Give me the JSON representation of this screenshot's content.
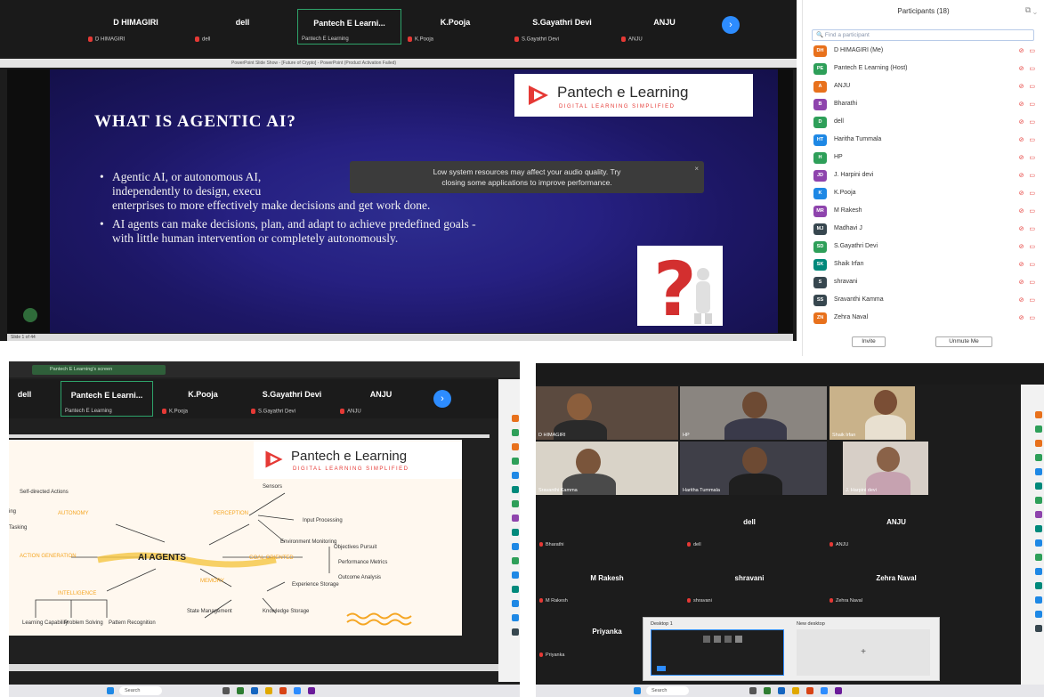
{
  "panel1": {
    "tiles": [
      {
        "name": "D HIMAGIRI",
        "sub": "D HIMAGIRI"
      },
      {
        "name": "dell",
        "sub": "dell"
      },
      {
        "name": "Pantech E Learni...",
        "sub": "Pantech E Learning",
        "active": true
      },
      {
        "name": "K.Pooja",
        "sub": "K.Pooja"
      },
      {
        "name": "S.Gayathri Devi",
        "sub": "S.Gayathri Devi"
      },
      {
        "name": "ANJU",
        "sub": "ANJU"
      }
    ],
    "share_title": "PowerPoint Slide Show - [Future of Crypto] - PowerPoint (Product Activation Failed)",
    "slide": {
      "title": "WHAT IS AGENTIC AI?",
      "bullet1_line1": "Agentic AI, or autonomous AI,",
      "bullet1_line2": "independently to design, execu",
      "bullet1_line3": "enterprises to more effectively make decisions and get work done.",
      "bullet2_line1": "AI agents can make decisions, plan, and adapt to achieve predefined goals -",
      "bullet2_line2": "with little human intervention or completely autonomously."
    },
    "logo": {
      "name": "Pantech e Learning",
      "tagline": "DIGITAL LEARNING SIMPLIFIED"
    },
    "toast": {
      "line1": "Low system resources may affect your audio quality. Try",
      "line2": "closing some applications to improve performance.",
      "close": "×"
    },
    "status": "Slide 1 of 44"
  },
  "participants": {
    "header": "Participants (18)",
    "search_placeholder": "Find a participant",
    "list": [
      {
        "initials": "DH",
        "name": "D HIMAGIRI (Me)",
        "color": "#e8711c"
      },
      {
        "initials": "PE",
        "name": "Pantech E Learning (Host)",
        "color": "#2e9f59"
      },
      {
        "initials": "A",
        "name": "ANJU",
        "color": "#e8711c"
      },
      {
        "initials": "B",
        "name": "Bharathi",
        "color": "#8e44ad"
      },
      {
        "initials": "D",
        "name": "dell",
        "color": "#2e9f59"
      },
      {
        "initials": "HT",
        "name": "Haritha Tummala",
        "color": "#1e88e5"
      },
      {
        "initials": "H",
        "name": "HP",
        "color": "#2e9f59"
      },
      {
        "initials": "JD",
        "name": "J. Harpini devi",
        "color": "#8e44ad"
      },
      {
        "initials": "K",
        "name": "K.Pooja",
        "color": "#1e88e5"
      },
      {
        "initials": "MR",
        "name": "M Rakesh",
        "color": "#8e44ad"
      },
      {
        "initials": "MJ",
        "name": "Madhavi J",
        "color": "#37474f"
      },
      {
        "initials": "SD",
        "name": "S.Gayathri Devi",
        "color": "#2e9f59"
      },
      {
        "initials": "SK",
        "name": "Shaik Irfan",
        "color": "#00897b"
      },
      {
        "initials": "S",
        "name": "shravani",
        "color": "#37474f"
      },
      {
        "initials": "SS",
        "name": "Sravanthi Kamma",
        "color": "#37474f"
      },
      {
        "initials": "ZN",
        "name": "Zehra Naval",
        "color": "#e8711c"
      }
    ],
    "invite": "Invite",
    "unmute_me": "Unmute Me"
  },
  "panel2": {
    "window_tab": "Pantech E Learning's screen",
    "tiles": [
      {
        "name": "dell",
        "sub": ""
      },
      {
        "name": "Pantech E Learni...",
        "sub": "Pantech E Learning",
        "active": true
      },
      {
        "name": "K.Pooja",
        "sub": "K.Pooja"
      },
      {
        "name": "S.Gayathri Devi",
        "sub": "S.Gayathri Devi"
      },
      {
        "name": "ANJU",
        "sub": "ANJU"
      }
    ],
    "logo": {
      "name": "Pantech e Learning",
      "tagline": "DIGITAL LEARNING SIMPLIFIED"
    },
    "map": {
      "center": "AI AGENTS",
      "nodes": {
        "self_directed": "Self-directed Actions",
        "autonomy": "AUTONOMY",
        "ing": "ing",
        "tasking": "Tasking",
        "perception": "PERCEPTION",
        "sensors": "Sensors",
        "input_proc": "Input Processing",
        "env_mon": "Environment Monitoring",
        "goal_oriented": "GOAL-ORIENTED",
        "objectives": "Objectives Pursuit",
        "perf_metrics": "Performance Metrics",
        "outcome": "Outcome Analysis",
        "action_gen": "ACTION GENERATION",
        "intelligence": "INTELLIGENCE",
        "learning": "Learning Capability",
        "problem": "Problem Solving",
        "pattern": "Pattern Recognition",
        "memory": "MEMORY",
        "state": "State Management",
        "experience": "Experience Storage",
        "knowledge": "Knowledge Storage"
      }
    }
  },
  "panel3": {
    "cams": [
      {
        "cap": "D HIMAGIRI"
      },
      {
        "cap": "HP"
      },
      {
        "cap": "Shaik Irfan"
      },
      {
        "cap": "Sravanthi Kamma"
      },
      {
        "cap": "Haritha Tummala"
      },
      {
        "cap": "J. Harpini devi"
      }
    ],
    "grid": [
      {
        "name": "",
        "sub": "Bharathi"
      },
      {
        "name": "dell",
        "sub": "dell"
      },
      {
        "name": "ANJU",
        "sub": "ANJU"
      },
      {
        "name": "M Rakesh",
        "sub": "M Rakesh"
      },
      {
        "name": "shravani",
        "sub": "shravani"
      },
      {
        "name": "Zehra Naval",
        "sub": "Zehra Naval"
      },
      {
        "name": "Priyanka",
        "sub": "Priyanka"
      }
    ],
    "desktop1": "Desktop 1",
    "new_desktop": "New desktop",
    "plus": "+"
  },
  "taskbar": {
    "search": "Search"
  }
}
